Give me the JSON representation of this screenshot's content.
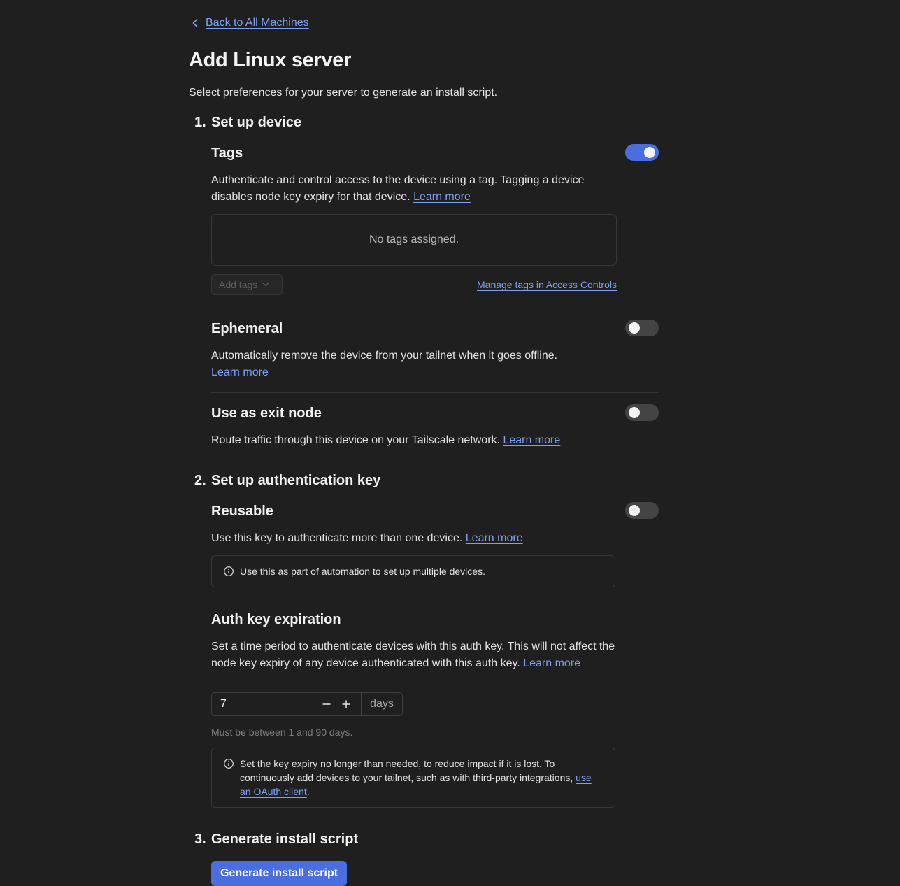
{
  "nav": {
    "back_label": "Back to All Machines"
  },
  "page": {
    "title": "Add Linux server",
    "subtitle": "Select preferences for your server to generate an install script."
  },
  "steps": [
    {
      "number": "1.",
      "title": "Set up device"
    },
    {
      "number": "2.",
      "title": "Set up authentication key"
    },
    {
      "number": "3.",
      "title": "Generate install script"
    }
  ],
  "tags": {
    "title": "Tags",
    "enabled": true,
    "description": "Authenticate and control access to the device using a tag. Tagging a device disables node key expiry for that device.",
    "learn_more": "Learn more",
    "empty_text": "No tags assigned.",
    "add_tags_label": "Add tags",
    "manage_link": "Manage tags in Access Controls"
  },
  "ephemeral": {
    "title": "Ephemeral",
    "enabled": false,
    "description": "Automatically remove the device from your tailnet when it goes offline.",
    "learn_more": "Learn more"
  },
  "exit_node": {
    "title": "Use as exit node",
    "enabled": false,
    "description": "Route traffic through this device on your Tailscale network.",
    "learn_more": "Learn more"
  },
  "reusable": {
    "title": "Reusable",
    "enabled": false,
    "description": "Use this key to authenticate more than one device.",
    "learn_more": "Learn more",
    "notice": "Use this as part of automation to set up multiple devices."
  },
  "expiration": {
    "title": "Auth key expiration",
    "description": "Set a time period to authenticate devices with this auth key. This will not affect the node key expiry of any device authenticated with this auth key.",
    "learn_more": "Learn more",
    "value": "7",
    "unit": "days",
    "hint": "Must be between 1 and 90 days.",
    "notice_text": "Set the key expiry no longer than needed, to reduce impact if it is lost. To continuously add devices to your tailnet, such as with third-party integrations,",
    "notice_link": "use an OAuth client",
    "notice_end": "."
  },
  "generate": {
    "button_label": "Generate install script"
  },
  "colors": {
    "background": "#1f1f1f",
    "accent": "#4a6ee0",
    "link": "#7fa0f5",
    "toggle_off": "#444444"
  }
}
